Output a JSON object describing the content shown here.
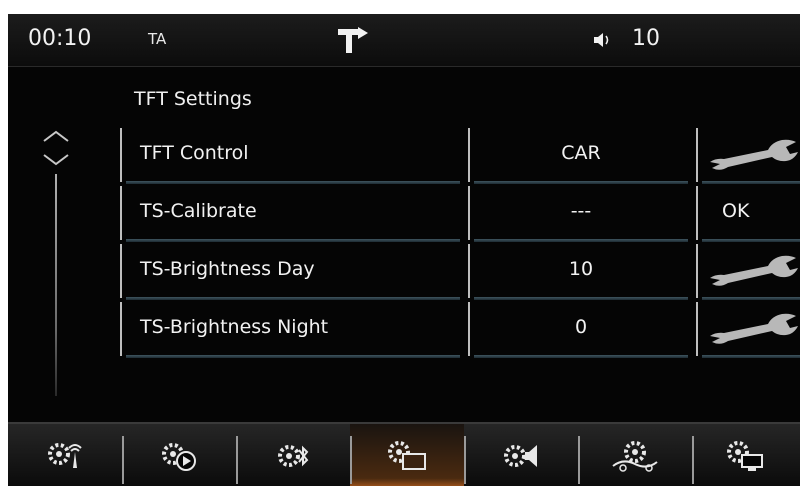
{
  "status": {
    "time": "00:10",
    "ta": "TA",
    "volume": "10",
    "icons": [
      "tp-icon",
      "volume-icon"
    ]
  },
  "page": {
    "title": "TFT Settings"
  },
  "rows": [
    {
      "label": "TFT Control",
      "value": "CAR",
      "action": "wrench-icon"
    },
    {
      "label": "TS-Calibrate",
      "value": "---",
      "action": "OK"
    },
    {
      "label": "TS-Brightness Day",
      "value": "10",
      "action": "wrench-icon"
    },
    {
      "label": "TS-Brightness Night",
      "value": "0",
      "action": "wrench-icon"
    }
  ],
  "toolbar": {
    "items": [
      "radio-settings-icon",
      "media-settings-icon",
      "bluetooth-settings-icon",
      "display-settings-icon",
      "sound-settings-icon",
      "navigation-settings-icon",
      "system-settings-icon"
    ],
    "active_index": 3
  },
  "colors": {
    "accent_active": "#a8581c",
    "background": "#050505",
    "row_underline": "#3e5560",
    "wrench": "#b8b8b8"
  }
}
